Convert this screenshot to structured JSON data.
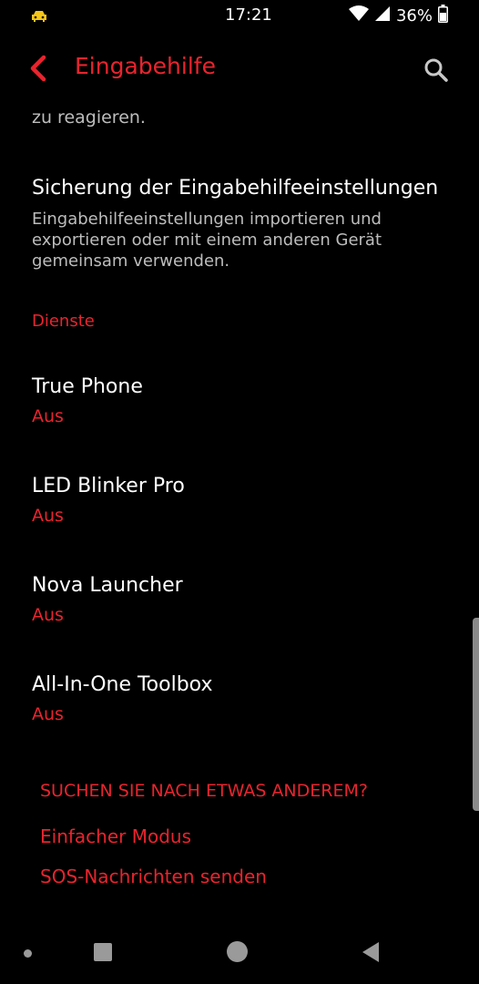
{
  "status_bar": {
    "time": "17:21",
    "battery": "36%",
    "icons": [
      "car-icon",
      "wifi-icon",
      "signal-icon",
      "battery-icon"
    ]
  },
  "app_bar": {
    "title": "Eingabehilfe",
    "back_icon": "chevron-left-icon",
    "search_icon": "search-icon",
    "accent_color": "#e8242e"
  },
  "list": {
    "truncated_text": "zu reagieren.",
    "backup": {
      "title": "Sicherung der Eingabehilfeeinstellungen",
      "summary": "Eingabehilfeeinstellungen importieren und exportieren oder mit einem anderen Gerät gemeinsam verwenden."
    },
    "section_header": "Dienste",
    "services": [
      {
        "name": "True Phone",
        "status": "Aus"
      },
      {
        "name": "LED Blinker Pro",
        "status": "Aus"
      },
      {
        "name": "Nova Launcher",
        "status": "Aus"
      },
      {
        "name": "All-In-One Toolbox",
        "status": "Aus"
      }
    ]
  },
  "suggestions": {
    "header": "SUCHEN SIE NACH ETWAS ANDEREM?",
    "links": [
      "Einfacher Modus",
      "SOS-Nachrichten senden"
    ]
  },
  "nav_bar": {
    "icons": [
      "dot-icon",
      "recents-icon",
      "home-icon",
      "back-icon"
    ]
  }
}
